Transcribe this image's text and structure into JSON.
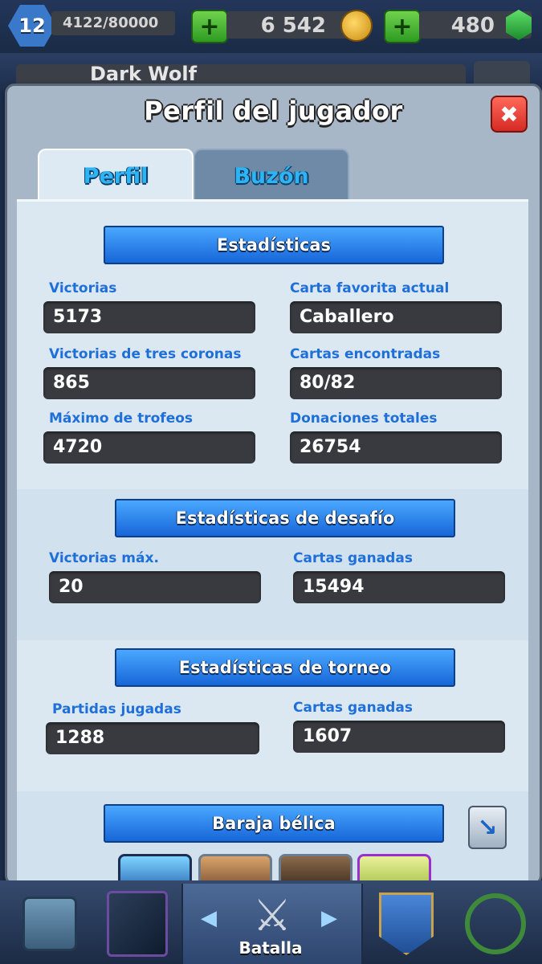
{
  "hud": {
    "level": "12",
    "xp": "4122/80000",
    "gold": "6 542",
    "gems": "480",
    "plus": "+"
  },
  "background": {
    "player_name": "Dark Wolf"
  },
  "modal": {
    "title": "Perfil del jugador",
    "close": "✖",
    "tabs": [
      {
        "label": "Perfil",
        "active": true
      },
      {
        "label": "Buzón",
        "active": false
      }
    ]
  },
  "stats": {
    "header": "Estadísticas",
    "left": [
      {
        "label": "Victorias",
        "value": "5173"
      },
      {
        "label": "Victorias de tres coronas",
        "value": "865"
      },
      {
        "label": "Máximo de trofeos",
        "value": "4720"
      }
    ],
    "right": [
      {
        "label": "Carta favorita actual",
        "value": "Caballero"
      },
      {
        "label": "Cartas encontradas",
        "value": "80/82"
      },
      {
        "label": "Donaciones totales",
        "value": "26754"
      }
    ]
  },
  "challenge": {
    "header": "Estadísticas de desafío",
    "left": {
      "label": "Victorias máx.",
      "value": "20"
    },
    "right": {
      "label": "Cartas ganadas",
      "value": "15494"
    }
  },
  "tournament": {
    "header": "Estadísticas de torneo",
    "left": {
      "label": "Partidas jugadas",
      "value": "1288"
    },
    "right": {
      "label": "Cartas ganadas",
      "value": "1607"
    }
  },
  "deck": {
    "header": "Baraja bélica"
  },
  "nav": {
    "battle_label": "Batalla",
    "arrow_left": "◀",
    "arrow_right": "▶"
  },
  "colors": {
    "accent_blue": "#1f6fd8",
    "value_bg": "#393a3f",
    "ribbon": "#2f86ee"
  }
}
